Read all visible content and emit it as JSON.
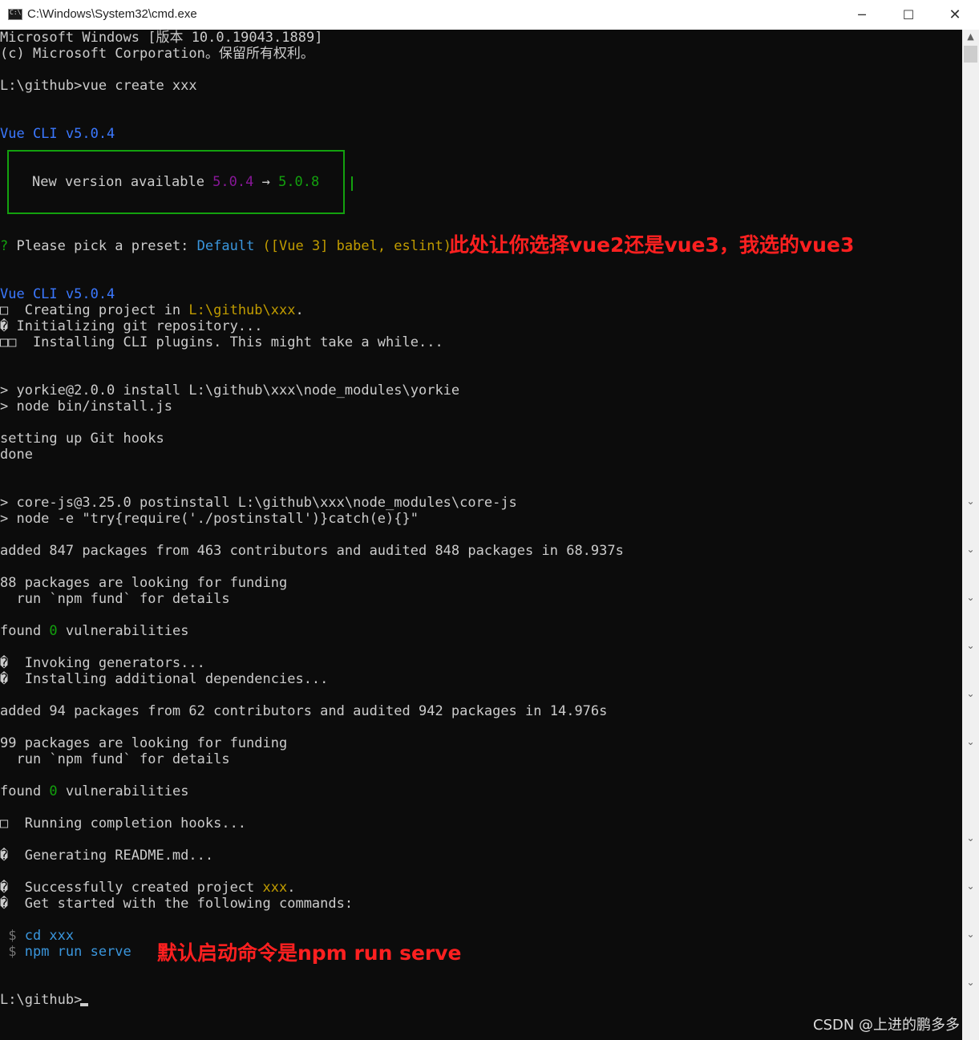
{
  "window": {
    "title": "C:\\Windows\\System32\\cmd.exe",
    "icon": "console-app-icon",
    "controls": {
      "minimize": "─",
      "maximize": "☐",
      "close": "✕"
    }
  },
  "colors": {
    "background": "#0c0c0c",
    "text": "#cccccc",
    "blue": "#3b78ff",
    "purple": "#881798",
    "green": "#13a10e",
    "yellow": "#c19c00",
    "teal": "#3a96dd",
    "annotation": "#ff2020"
  },
  "console": {
    "banner1": "Microsoft Windows [版本 10.0.19043.1889]",
    "banner2": "(c) Microsoft Corporation。保留所有权利。",
    "prompt1": "L:\\github>vue create xxx",
    "cli_version_1": "Vue CLI v5.0.4",
    "update_box": {
      "label": "New version available ",
      "from_version": "5.0.4",
      "arrow": " → ",
      "to_version": "5.0.8"
    },
    "preset": {
      "q": "?",
      "label": " Please pick a preset: ",
      "value": "Default",
      "detail": " ([Vue 3] babel, eslint)"
    },
    "cli_version_2": "Vue CLI v5.0.4",
    "creating_prefix": "□  Creating project in ",
    "creating_path": "L:\\github\\xxx",
    "creating_suffix": ".",
    "init_git": "� Initializing git repository...",
    "installing_plugins": "□□  Installing CLI plugins. This might take a while...",
    "yorkie_1": "> yorkie@2.0.0 install L:\\github\\xxx\\node_modules\\yorkie",
    "yorkie_2": "> node bin/install.js",
    "git_hooks": "setting up Git hooks",
    "done": "done",
    "corejs_1": "> core-js@3.25.0 postinstall L:\\github\\xxx\\node_modules\\core-js",
    "corejs_2": "> node -e \"try{require('./postinstall')}catch(e){}\"",
    "added_1": "added 847 packages from 463 contributors and audited 848 packages in 68.937s",
    "funding_1a": "88 packages are looking for funding",
    "funding_1b": "  run `npm fund` for details",
    "found_1_prefix": "found ",
    "found_1_count": "0",
    "found_1_suffix": " vulnerabilities",
    "invoking": "�  Invoking generators...",
    "installing_deps": "�  Installing additional dependencies...",
    "added_2": "added 94 packages from 62 contributors and audited 942 packages in 14.976s",
    "funding_2a": "99 packages are looking for funding",
    "funding_2b": "  run `npm fund` for details",
    "found_2_prefix": "found ",
    "found_2_count": "0",
    "found_2_suffix": " vulnerabilities",
    "hooks": "□  Running completion hooks...",
    "readme": "�  Generating README.md...",
    "success_prefix": "�  Successfully created project ",
    "success_name": "xxx",
    "success_suffix": ".",
    "get_started": "�  Get started with the following commands:",
    "cmd_1_sym": " $ ",
    "cmd_1": "cd xxx",
    "cmd_2_sym": " $ ",
    "cmd_2": "npm run serve",
    "prompt2": "L:\\github>"
  },
  "annotations": {
    "preset_note": "此处让你选择vue2还是vue3，我选的vue3",
    "serve_note": "默认启动命令是npm run serve"
  },
  "scrollbar": {
    "up_arrow": "▲",
    "down_arrow": "⌄"
  },
  "watermark": "CSDN @上进的鹏多多"
}
